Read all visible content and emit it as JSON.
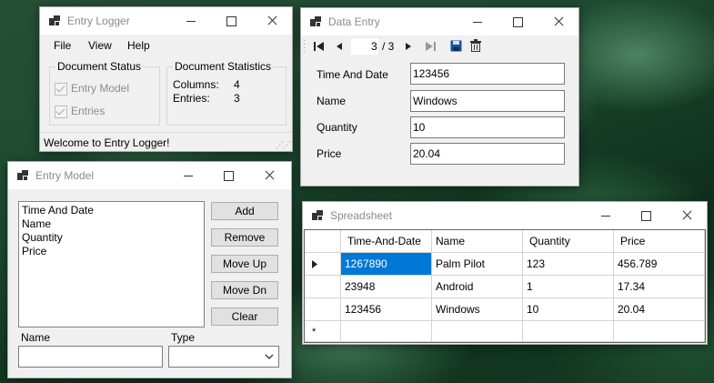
{
  "entry_logger": {
    "title": "Entry Logger",
    "menu": [
      "File",
      "View",
      "Help"
    ],
    "doc_status": {
      "legend": "Document Status",
      "entry_model": "Entry Model",
      "entries": "Entries"
    },
    "doc_stats": {
      "legend": "Document Statistics",
      "columns_label": "Columns:",
      "columns_value": "4",
      "entries_label": "Entries:",
      "entries_value": "3"
    },
    "status": "Welcome to Entry Logger!"
  },
  "data_entry": {
    "title": "Data Entry",
    "nav": {
      "position": "3",
      "of": "/ 3"
    },
    "fields": [
      {
        "label": "Time And Date",
        "value": "123456"
      },
      {
        "label": "Name",
        "value": "Windows"
      },
      {
        "label": "Quantity",
        "value": "10"
      },
      {
        "label": "Price",
        "value": "20.04"
      }
    ]
  },
  "entry_model": {
    "title": "Entry Model",
    "items": [
      "Time And Date",
      "Name",
      "Quantity",
      "Price"
    ],
    "buttons": {
      "add": "Add",
      "remove": "Remove",
      "move_up": "Move Up",
      "move_dn": "Move Dn",
      "clear": "Clear"
    },
    "name_label": "Name",
    "name_value": "",
    "type_label": "Type",
    "type_value": ""
  },
  "spreadsheet": {
    "title": "Spreadsheet",
    "columns": [
      "Time-And-Date",
      "Name",
      "Quantity",
      "Price"
    ],
    "rows": [
      [
        "1267890",
        "Palm Pilot",
        "123",
        "456.789"
      ],
      [
        "23948",
        "Android",
        "1",
        "17.34"
      ],
      [
        "123456",
        "Windows",
        "10",
        "20.04"
      ]
    ],
    "new_row_marker": "*"
  }
}
